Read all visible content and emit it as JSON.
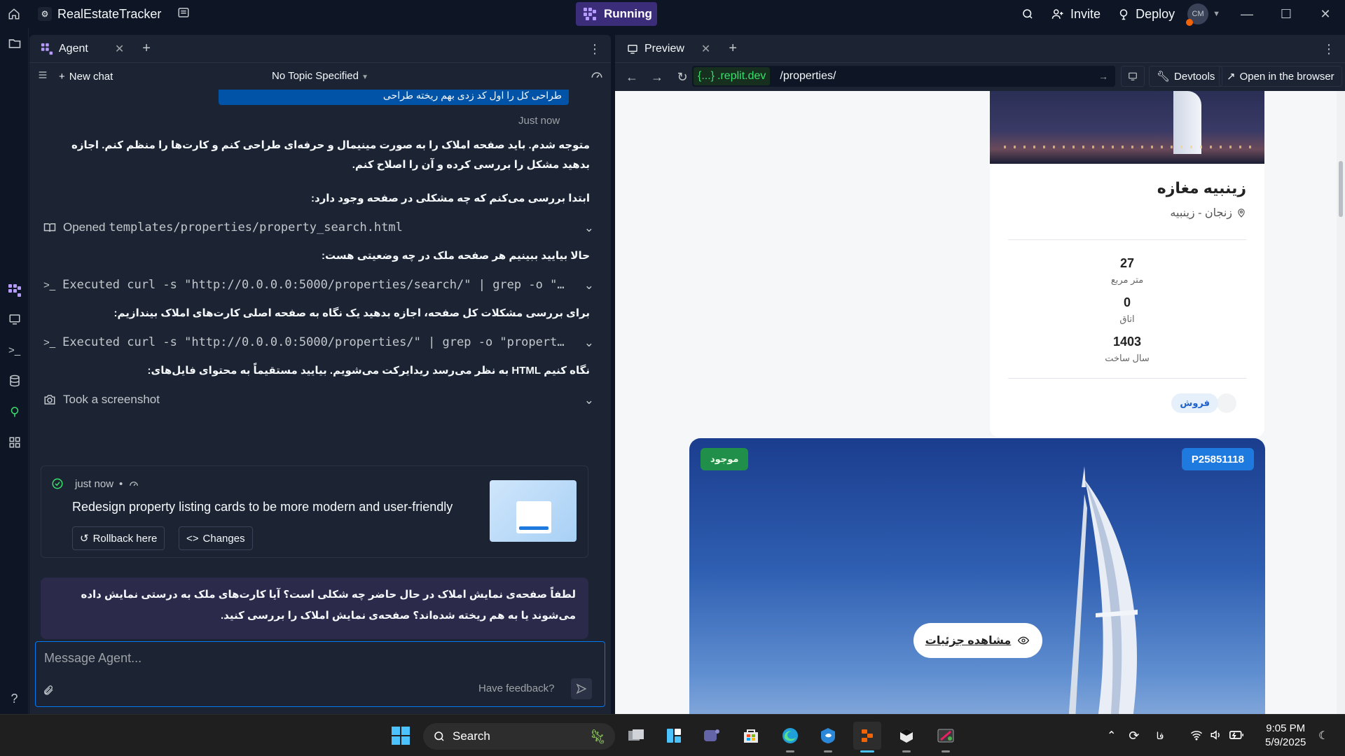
{
  "app": {
    "title": "RealEstateTracker",
    "run_state": "Running",
    "invite_label": "Invite",
    "deploy_label": "Deploy",
    "avatar_initials": "CM"
  },
  "agent": {
    "tab_label": "Agent",
    "new_chat_label": "New chat",
    "topic_label": "No Topic Specified",
    "top_bubble_text": "طراحی کل را اول کد زدی بهم ریخته طراحی",
    "timestamp": "Just now",
    "messages": [
      "متوجه شدم. باید صفحه املاک را به صورت مینیمال و حرفه‌ای طراحی کنم و کارت‌ها را منظم کنم. اجازه بدهید مشکل را بررسی کرده و آن را اصلاح کنم.",
      "ابتدا بررسی می‌کنم که چه مشکلی در صفحه وجود دارد:",
      "حالا بیایید ببینیم هر صفحه ملک در چه وضعیتی هست:",
      "برای بررسی مشکلات کل صفحه، اجازه بدهید یک نگاه به صفحه اصلی کارت‌های املاک بیندازیم:",
      "نگاه کنیم HTML به نظر می‌رسد ریدایرکت می‌شویم. بیایید مستقیماً به محتوای فایل‌های:"
    ],
    "actions": {
      "open_file_prefix": "Opened",
      "open_file_path": "templates/properties/property_search.html",
      "curl1": "Executed curl -s \"http://0.0.0.0:5000/properties/search/\" | grep -o \"pro...",
      "curl2": "Executed curl -s \"http://0.0.0.0:5000/properties/\" | grep -o \"property-c...",
      "screenshot": "Took a screenshot"
    },
    "checkpoint": {
      "time": "just now",
      "title": "Redesign property listing cards to be more modern and user-friendly",
      "rollback_label": "Rollback here",
      "changes_label": "Changes"
    },
    "user_message": "لطفاً صفحه‌ی نمایش املاک در حال حاضر چه شکلی است؟ آیا کارت‌های ملک به درستی نمایش داده می‌شوند یا به هم ریخته شده‌اند؟ صفحه‌ی نمایش املاک را بررسی کنید.",
    "composer": {
      "placeholder": "Message Agent...",
      "feedback_label": "Have feedback?"
    }
  },
  "preview": {
    "tab_label": "Preview",
    "url_badge": "{...}",
    "url_domain": ".replit.dev",
    "url_path": "/properties/",
    "devtools_label": "Devtools",
    "open_browser_label": "Open in the browser",
    "card1": {
      "title": "زینبیه مغازه",
      "location": "زنجان - زینبیه",
      "stats": [
        {
          "value": "27",
          "label": "متر مربع"
        },
        {
          "value": "0",
          "label": "اتاق"
        },
        {
          "value": "1403",
          "label": "سال ساخت"
        }
      ],
      "deal_type": "فروش"
    },
    "card2": {
      "availability": "موجود",
      "code": "P25851118",
      "view_label": "مشاهده جزئیات"
    }
  },
  "taskbar": {
    "search_label": "Search",
    "lang": "فا",
    "time": "9:05 PM",
    "date": "5/9/2025"
  },
  "colors": {
    "bg": "#0e1525",
    "panel": "#1c2333",
    "accent": "#0079f2",
    "running": "#3c2d7a",
    "badge_green": "#1f8f4a",
    "badge_blue": "#1f7ae0"
  }
}
